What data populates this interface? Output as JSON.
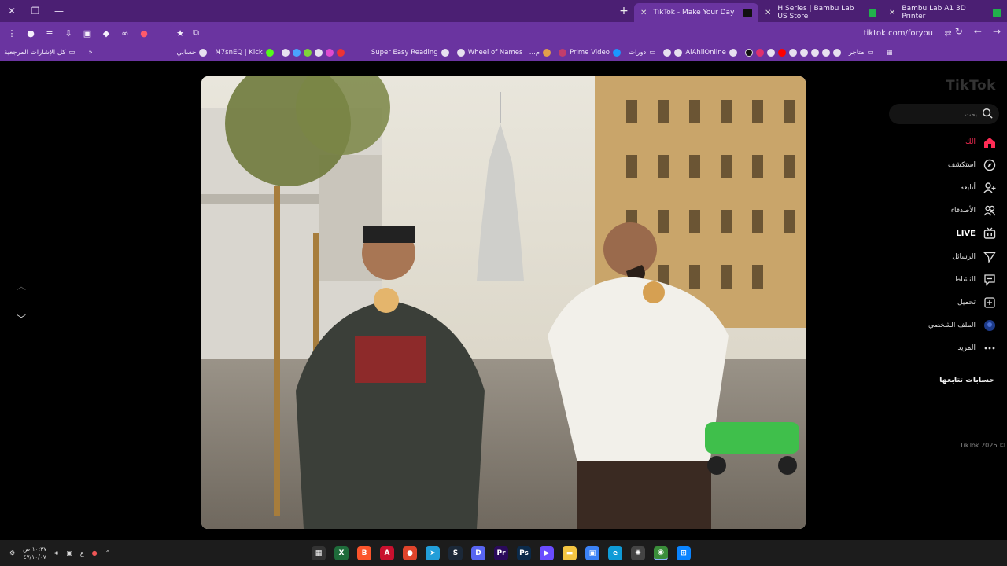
{
  "window": {
    "tabs": [
      {
        "label": "TikTok - Make Your Day",
        "active": true,
        "favicon_color": "#111111"
      },
      {
        "label": "H Series | Bambu Lab US Store",
        "active": false,
        "favicon_color": "#22b14c"
      },
      {
        "label": "Bambu Lab A1 3D Printer",
        "active": false,
        "favicon_color": "#22b14c"
      }
    ]
  },
  "toolbar": {
    "url": "tiktok.com/foryou"
  },
  "bookmarks": {
    "all_bookmarks": "كل الإشارات المرجعية",
    "items": [
      "حسابي",
      "M7snEQ | Kick",
      "Super Easy Reading",
      "Wheel of Names | ...م",
      "Prime Video",
      "دورات",
      "AlAhliOnline",
      "متاجر"
    ]
  },
  "sidebar": {
    "logo": "TikTok",
    "search_placeholder": "بحث",
    "nav": [
      {
        "label": "الك",
        "icon": "home-icon"
      },
      {
        "label": "استكشف",
        "icon": "compass-icon"
      },
      {
        "label": "أتابعه",
        "icon": "user-plus-icon"
      },
      {
        "label": "الأصدقاء",
        "icon": "friends-icon"
      },
      {
        "label": "LIVE",
        "icon": "live-icon"
      },
      {
        "label": "الرسائل",
        "icon": "send-icon"
      },
      {
        "label": "النشاط",
        "icon": "message-icon"
      },
      {
        "label": "تحميل",
        "icon": "upload-icon"
      },
      {
        "label": "الملف الشخصي",
        "icon": "avatar-icon"
      },
      {
        "label": "المزيد",
        "icon": "more-icon"
      }
    ],
    "following_heading": "حسابات تتابعها",
    "copyright": "TikTok 2026 ©"
  },
  "taskbar": {
    "time": "١٠:٣٧ ص",
    "date": "٤٧/١٠/٠٧",
    "lang": "ع",
    "accent": "#6a34a0"
  }
}
